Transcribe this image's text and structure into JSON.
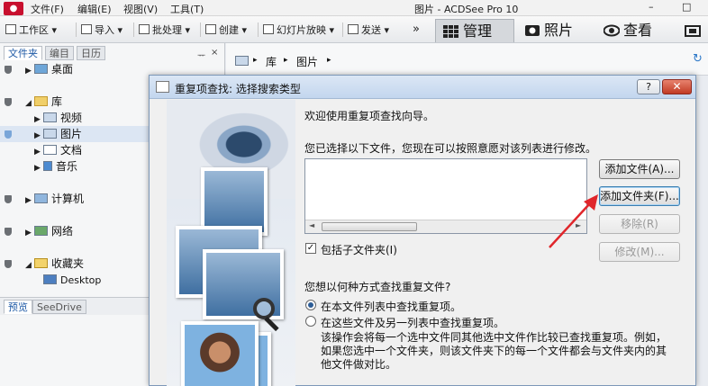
{
  "app": {
    "title": "图片 - ACDSee Pro 10",
    "icon": "camera-icon",
    "menus": [
      "文件(F)",
      "编辑(E)",
      "视图(V)",
      "工具(T)"
    ],
    "window_controls": {
      "minimize": "–",
      "maximize": "□"
    }
  },
  "toolbar": {
    "workspace": "工作区",
    "import": "导入",
    "batch": "批处理",
    "create": "创建",
    "slideshow": "幻灯片放映",
    "send": "发送",
    "more": "»",
    "modes": {
      "manage": "管理",
      "photos": "照片",
      "view": "查看"
    }
  },
  "leftpanel": {
    "tabs": [
      "文件夹",
      "编目",
      "日历"
    ],
    "pin": "ᅲ",
    "close": "×",
    "tree": {
      "desktop": "桌面",
      "library": "库",
      "videos": "视频",
      "pictures": "图片",
      "documents": "文档",
      "music": "音乐",
      "computer": "计算机",
      "network": "网络",
      "favorites": "收藏夹",
      "fav_desktop": "Desktop"
    },
    "bottom_tabs": [
      "预览",
      "SeeDrive"
    ]
  },
  "breadcrumb": {
    "items": [
      "库",
      "图片"
    ],
    "sep": "▸"
  },
  "dialog": {
    "title": "重复项查找: 选择搜索类型",
    "help": "?",
    "close": "✕",
    "welcome": "欢迎使用重复项查找向导。",
    "prompt": "您已选择以下文件，您现在可以按照意愿对该列表进行修改。",
    "buttons": {
      "add_file": "添加文件(A)...",
      "add_folder": "添加文件夹(F)...",
      "remove": "移除(R)",
      "modify": "修改(M)..."
    },
    "include_subfolders": "包括子文件夹(I)",
    "search_question": "您想以何种方式查找重复文件?",
    "option1": "在本文件列表中查找重复项。",
    "option2": "在这些文件及另一列表中查找重复项。",
    "description": "该操作会将每一个选中文件同其他选中文件作比较已查找重复项。例如，如果您选中一个文件夹，则该文件夹下的每一个文件都会与文件夹内的其他文件做对比。",
    "scroll_left": "◄",
    "scroll_right": "►",
    "check": "✓"
  },
  "colors": {
    "accent": "#2d5d96",
    "annotation_arrow": "#e0262b",
    "close": "#c13b24"
  }
}
